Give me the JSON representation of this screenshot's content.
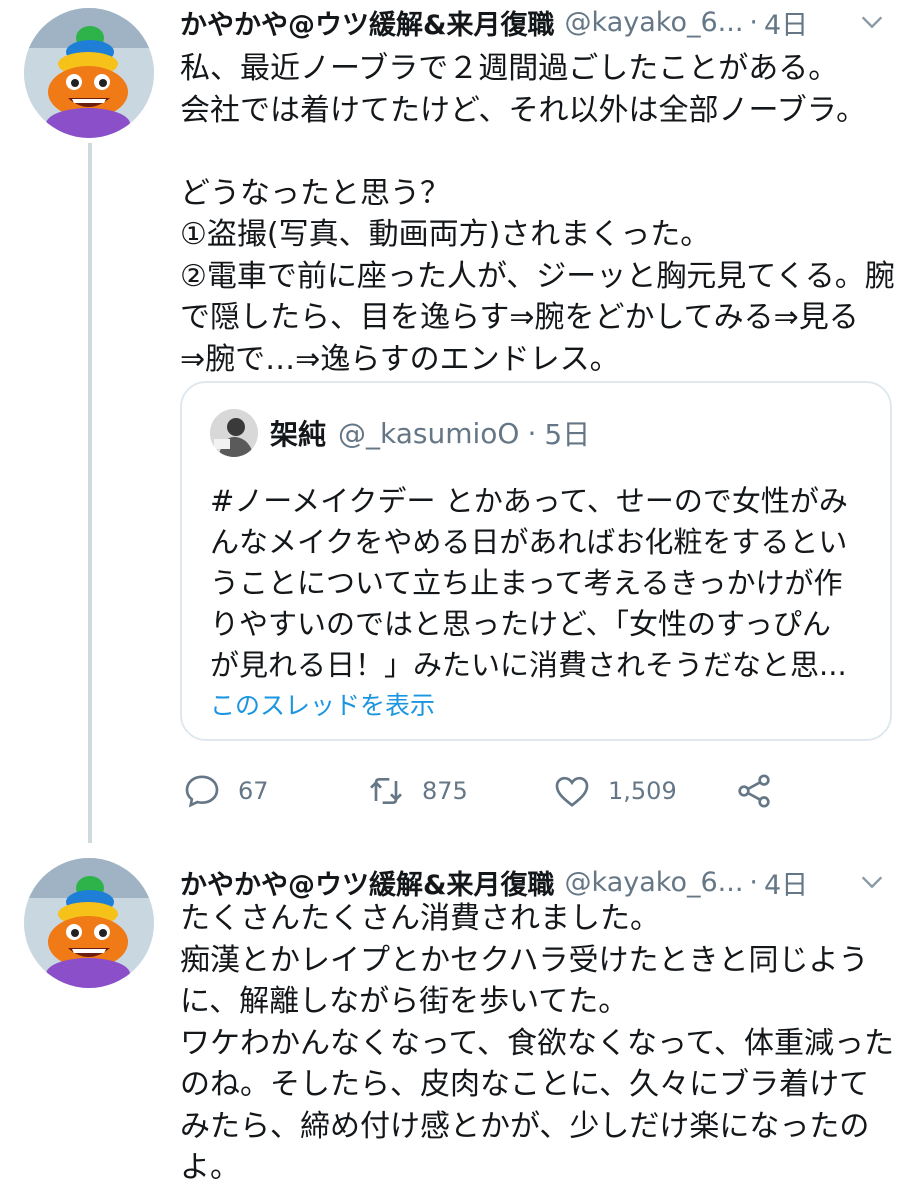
{
  "tweet1": {
    "display_name": "かやかや@ウツ緩解&来月復職",
    "handle": "@kayako_6...",
    "separator": "·",
    "time": "4日",
    "lines": [
      "私、最近ノーブラで２週間過ごしたことがある。",
      "会社では着けてたけど、それ以外は全部ノーブラ。",
      "",
      "どうなったと思う？",
      "①盗撮(写真、動画両方)されまくった。",
      "②電車で前に座った人が、ジーッと胸元見てくる。腕",
      "で隠したら、目を逸らす⇒腕をどかしてみる⇒見る",
      "⇒腕で…⇒逸らすのエンドレス。"
    ],
    "quote": {
      "display_name": "架純",
      "handle": "@_kasumioO",
      "separator": "·",
      "time": "5日",
      "lines": [
        "#ノーメイクデー とかあって、せーので女性がみ",
        "んなメイクをやめる日があればお化粧をするとい",
        "うことについて立ち止まって考えるきっかけが作",
        "りやすいのではと思ったけど、「女性のすっぴん",
        "が見れる日！」みたいに消費されそうだなと思..."
      ],
      "show_thread": "このスレッドを表示"
    },
    "actions": {
      "reply_count": "67",
      "retweet_count": "875",
      "like_count": "1,509"
    }
  },
  "tweet2": {
    "display_name": "かやかや@ウツ緩解&来月復職",
    "handle": "@kayako_6...",
    "separator": "·",
    "time": "4日",
    "lines": [
      "たくさんたくさん消費されました。",
      "痴漢とかレイプとかセクハラ受けたときと同じよう",
      "に、解離しながら街を歩いてた。",
      "ワケわかんなくなって、食欲なくなって、体重減った",
      "のね。そしたら、皮肉なことに、久々にブラ着けて",
      "みたら、締め付け感とかが、少しだけ楽になったの",
      "よ。"
    ]
  },
  "icons": {
    "avatar": "rainbow-poop-figure",
    "chevron": "chevron-down-icon",
    "reply": "reply-icon",
    "retweet": "retweet-icon",
    "like": "heart-icon",
    "share": "share-icon"
  }
}
